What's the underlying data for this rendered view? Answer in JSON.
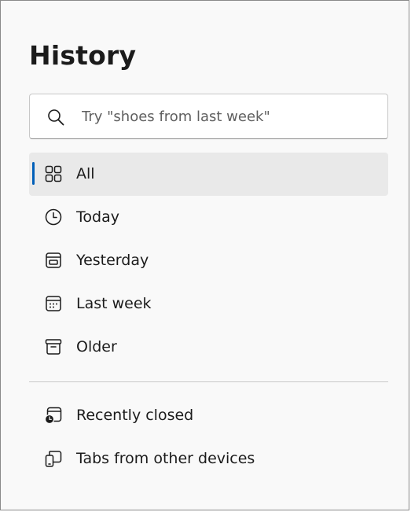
{
  "header": {
    "title": "History"
  },
  "search": {
    "placeholder": "Try \"shoes from last week\"",
    "icon": "search-icon"
  },
  "filters": [
    {
      "label": "All",
      "icon": "grid-icon",
      "selected": true
    },
    {
      "label": "Today",
      "icon": "clock-icon",
      "selected": false
    },
    {
      "label": "Yesterday",
      "icon": "calendar-day-icon",
      "selected": false
    },
    {
      "label": "Last week",
      "icon": "calendar-week-icon",
      "selected": false
    },
    {
      "label": "Older",
      "icon": "archive-icon",
      "selected": false
    }
  ],
  "secondary": [
    {
      "label": "Recently closed",
      "icon": "recently-closed-icon"
    },
    {
      "label": "Tabs from other devices",
      "icon": "devices-icon"
    }
  ],
  "colors": {
    "accent": "#005fb8",
    "selected_bg": "#e9e9e9",
    "panel_bg": "#f9f9f9"
  }
}
